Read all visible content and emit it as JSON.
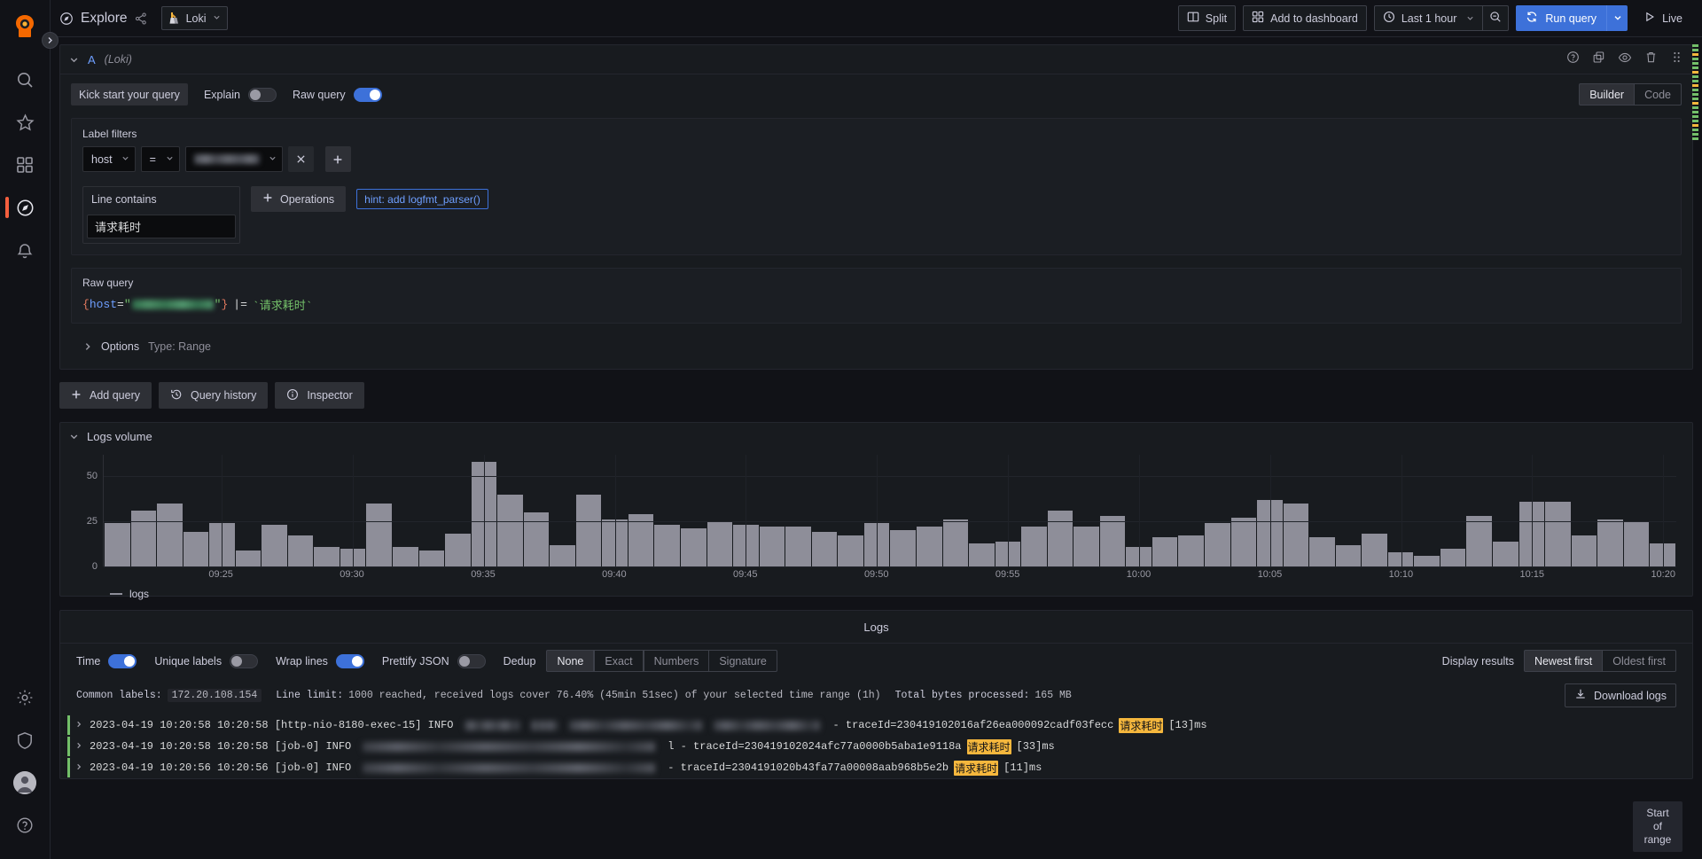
{
  "app": {
    "brand_icon": "grafana-logo-icon",
    "accent_color": "#f55f3e",
    "primary_color": "#3d71d9"
  },
  "rail": {
    "expand_icon": "chevron-right-icon",
    "items": [
      {
        "name": "search",
        "icon": "search-icon"
      },
      {
        "name": "starred",
        "icon": "star-icon"
      },
      {
        "name": "dashboards",
        "icon": "dashboards-grid-icon"
      },
      {
        "name": "explore",
        "icon": "compass-icon",
        "active": true
      },
      {
        "name": "alerting",
        "icon": "bell-icon"
      }
    ],
    "bottom_items": [
      {
        "name": "configuration",
        "icon": "gear-icon"
      },
      {
        "name": "server-admin",
        "icon": "shield-icon"
      },
      {
        "name": "profile",
        "icon": "avatar-icon"
      },
      {
        "name": "help",
        "icon": "question-circle-icon"
      }
    ]
  },
  "topnav": {
    "page_icon": "compass-icon",
    "title": "Explore",
    "share_icon": "share-nodes-icon",
    "datasource": {
      "icon": "loki-logo-icon",
      "label": "Loki",
      "caret": "chevron-down-icon"
    },
    "split_label": "Split",
    "split_icon": "columns-icon",
    "add_to_dashboard_label": "Add to dashboard",
    "add_to_dashboard_icon": "apps-grid-icon",
    "time_range_label": "Last 1 hour",
    "time_range_icon": "clock-icon",
    "time_range_caret": "chevron-down-icon",
    "zoom_out_icon": "search-minus-icon",
    "run_query_label": "Run query",
    "run_query_icon": "sync-icon",
    "run_query_caret": "chevron-down-icon",
    "live_label": "Live",
    "live_icon": "play-icon"
  },
  "query": {
    "collapse_icon": "chevron-down-icon",
    "ref_id": "A",
    "datasource_note": "(Loki)",
    "header_icons": [
      {
        "name": "query-help-icon",
        "glyph": "?"
      },
      {
        "name": "duplicate-query-icon",
        "glyph": "copy"
      },
      {
        "name": "hide-response-icon",
        "glyph": "eye"
      },
      {
        "name": "remove-query-icon",
        "glyph": "trash"
      },
      {
        "name": "drag-handle-icon",
        "glyph": "grip"
      }
    ],
    "kick_start_label": "Kick start your query",
    "explain_label": "Explain",
    "explain_on": false,
    "raw_query_label": "Raw query",
    "raw_query_on": true,
    "mode_tabs": [
      {
        "label": "Builder",
        "active": true
      },
      {
        "label": "Code",
        "active": false
      }
    ],
    "label_filters_title": "Label filters",
    "filter": {
      "label_key": "host",
      "operator": "=",
      "value_blurred": true,
      "remove_icon": "close-icon",
      "add_icon": "plus-icon"
    },
    "line_contains_label": "Line contains",
    "line_contains_value": "请求耗时",
    "operations_label": "Operations",
    "operations_icon": "plus-icon",
    "hint_label": "hint: add logfmt_parser()",
    "raw_query_section_title": "Raw query",
    "raw_query_parts": {
      "open": "{",
      "key": "host",
      "equals": "=",
      "value_blurred": true,
      "close": "}",
      "pipe": "|=",
      "search_term": "`请求耗时`"
    },
    "options": {
      "expand_icon": "chevron-right-icon",
      "label": "Options",
      "summary": "Type: Range"
    },
    "actions": [
      {
        "label": "Add query",
        "icon": "plus-icon"
      },
      {
        "label": "Query history",
        "icon": "history-icon"
      },
      {
        "label": "Inspector",
        "icon": "info-circle-icon"
      }
    ]
  },
  "logs_volume": {
    "collapse_icon": "chevron-down-icon",
    "title": "Logs volume",
    "legend_label": "logs"
  },
  "chart_data": {
    "type": "bar",
    "title": "Logs volume",
    "xlabel": "",
    "ylabel": "",
    "ylim": [
      0,
      62
    ],
    "yticks": [
      0,
      25,
      50
    ],
    "grid": true,
    "legend": {
      "position": "bottom-left",
      "entries": [
        "logs"
      ]
    },
    "xticks": [
      "09:25",
      "09:30",
      "09:35",
      "09:40",
      "09:45",
      "09:50",
      "09:55",
      "10:00",
      "10:05",
      "10:10",
      "10:15",
      "10:20"
    ],
    "series": [
      {
        "name": "logs",
        "color": "#8e8e99",
        "values": [
          24,
          31,
          35,
          19,
          24,
          9,
          23,
          17,
          11,
          10,
          35,
          11,
          9,
          18,
          58,
          40,
          30,
          12,
          40,
          26,
          29,
          23,
          21,
          25,
          23,
          22,
          22,
          19,
          17,
          24,
          20,
          22,
          26,
          13,
          14,
          22,
          31,
          22,
          28,
          11,
          16,
          17,
          24,
          27,
          37,
          35,
          16,
          12,
          18,
          8,
          6,
          10,
          28,
          14,
          36,
          36,
          17,
          26,
          25,
          13
        ]
      }
    ]
  },
  "logs": {
    "title": "Logs",
    "controls": [
      {
        "label": "Time",
        "on": true
      },
      {
        "label": "Unique labels",
        "on": false
      },
      {
        "label": "Wrap lines",
        "on": true
      },
      {
        "label": "Prettify JSON",
        "on": false
      }
    ],
    "dedup_label": "Dedup",
    "dedup_options": [
      {
        "label": "None",
        "active": true
      },
      {
        "label": "Exact",
        "active": false
      },
      {
        "label": "Numbers",
        "active": false
      },
      {
        "label": "Signature",
        "active": false
      }
    ],
    "display_results_label": "Display results",
    "order_options": [
      {
        "label": "Newest first",
        "active": true
      },
      {
        "label": "Oldest first",
        "active": false
      }
    ],
    "meta": {
      "common_labels_key": "Common labels:",
      "common_labels_value": "172.20.108.154",
      "line_limit_key": "Line limit:",
      "line_limit_value": "1000 reached, received logs cover 76.40% (45min 51sec) of your selected time range (1h)",
      "total_bytes_key": "Total bytes processed:",
      "total_bytes_value": "165 MB"
    },
    "download_label": "Download logs",
    "download_icon": "download-icon",
    "rows": [
      {
        "expand_icon": "chevron-right-icon",
        "level_color": "#73bf69",
        "timestamp": "2023-04-19 10:20:58",
        "time": "10:20:58",
        "thread": "[http-nio-8180-exec-15]",
        "level": "INFO",
        "masked_widths": [
          62,
          30,
          150,
          120
        ],
        "trace_prefix": "- traceId=230419102016af26ea000092cadf03fecc",
        "highlight": "请求耗时",
        "duration": "[13]ms"
      },
      {
        "expand_icon": "chevron-right-icon",
        "level_color": "#73bf69",
        "timestamp": "2023-04-19 10:20:58",
        "time": "10:20:58",
        "thread": "[job-0]",
        "level": "INFO",
        "masked_widths": [
          330
        ],
        "trace_prefix": "l - traceId=230419102024afc77a0000b5aba1e9118a",
        "highlight": "请求耗时",
        "duration": "[33]ms"
      },
      {
        "expand_icon": "chevron-right-icon",
        "level_color": "#73bf69",
        "timestamp": "2023-04-19 10:20:56",
        "time": "10:20:56",
        "thread": "[job-0]",
        "level": "INFO",
        "masked_widths": [
          330
        ],
        "trace_prefix": "- traceId=2304191020b43fa77a00008aab968b5e2b",
        "highlight": "请求耗时",
        "duration": "[11]ms"
      }
    ],
    "start_of_range_label": "Start of range"
  }
}
